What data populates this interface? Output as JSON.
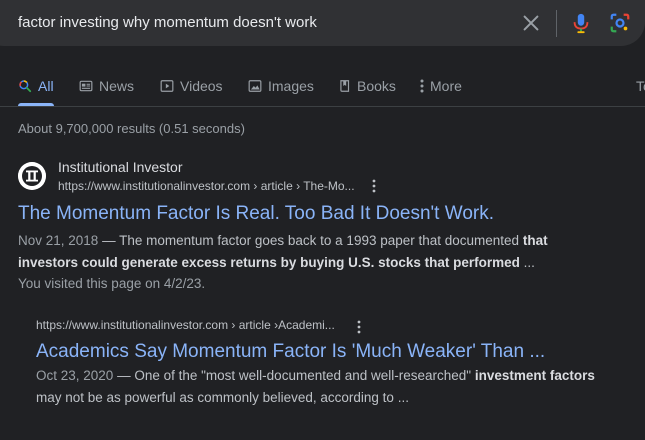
{
  "search": {
    "query": "factor investing why momentum doesn't work"
  },
  "tabs": [
    {
      "label": "All",
      "active": true,
      "icon": "search-icon"
    },
    {
      "label": "News",
      "icon": "news-icon"
    },
    {
      "label": "Videos",
      "icon": "play-icon"
    },
    {
      "label": "Images",
      "icon": "image-icon"
    },
    {
      "label": "Books",
      "icon": "book-icon"
    },
    {
      "label": "More",
      "icon": "more-vert-icon"
    },
    {
      "label": "To",
      "partial": true
    }
  ],
  "stats": "About 9,700,000 results (0.51 seconds)",
  "results": [
    {
      "site_name": "Institutional Investor",
      "url": "https://www.institutionalinvestor.com › article › The-Mo...",
      "title": "The Momentum Factor Is Real. Too Bad It Doesn't Work.",
      "date": "Nov 21, 2018",
      "separator": " — ",
      "snippet_line1": "The momentum factor goes back to a 1993 paper that documented ",
      "snippet_bold1": "that",
      "snippet_bold2": "investors could generate excess returns by buying U.S. stocks that performed",
      "ellipsis": " ...",
      "visited": "You visited this page on 4/2/23."
    },
    {
      "url": "https://www.institutionalinvestor.com › article ›Academi...",
      "title": "Academics Say Momentum Factor Is 'Much Weaker' Than ...",
      "date": "Oct 23, 2020",
      "separator": " — ",
      "snippet_line1": "One of the \"most well-documented and well-researched\" ",
      "snippet_bold1": "investment factors",
      "snippet_line2": "may not be as powerful as commonly believed, according to",
      "ellipsis": " ..."
    }
  ]
}
